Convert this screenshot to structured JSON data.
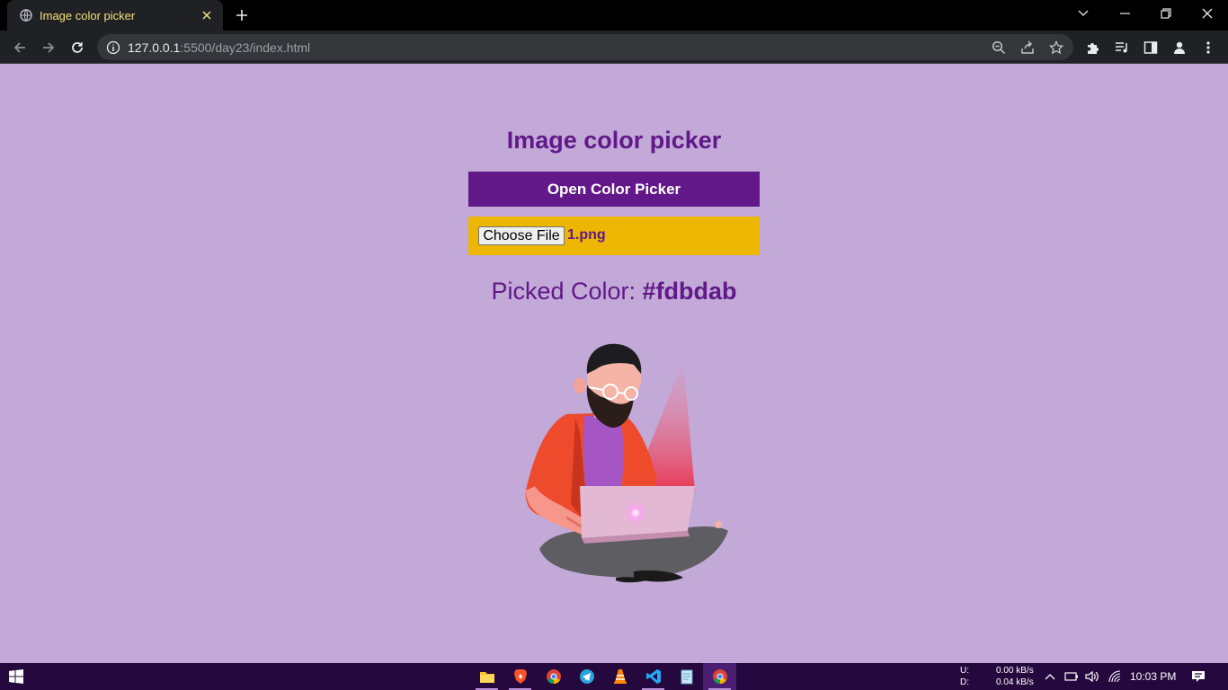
{
  "browser": {
    "tab_title": "Image color picker",
    "url_host": "127.0.0.1",
    "url_rest": ":5500/day23/index.html",
    "tab_title_color": "#f5e27a",
    "chrome_bg": "#202124"
  },
  "page": {
    "background": "#c2a9d8",
    "accent": "#621889",
    "heading": "Image color picker",
    "open_button_label": "Open Color Picker",
    "file_box_color": "#ecb602",
    "choose_file_label": "Choose File",
    "file_name": "1.png",
    "picked_label": "Picked Color:",
    "picked_value": "#fdbdab",
    "illustration": "bearded-man-with-laptop-illustration"
  },
  "taskbar": {
    "apps": [
      "file-explorer-icon",
      "brave-browser-icon",
      "chrome-icon",
      "telegram-icon",
      "vlc-icon",
      "vscode-icon",
      "notepad-icon",
      "chrome-profile-icon"
    ],
    "upload_label": "U:",
    "download_label": "D:",
    "upload_speed": "0.00 kB/s",
    "download_speed": "0.04 kB/s",
    "time": "10:03 PM"
  }
}
